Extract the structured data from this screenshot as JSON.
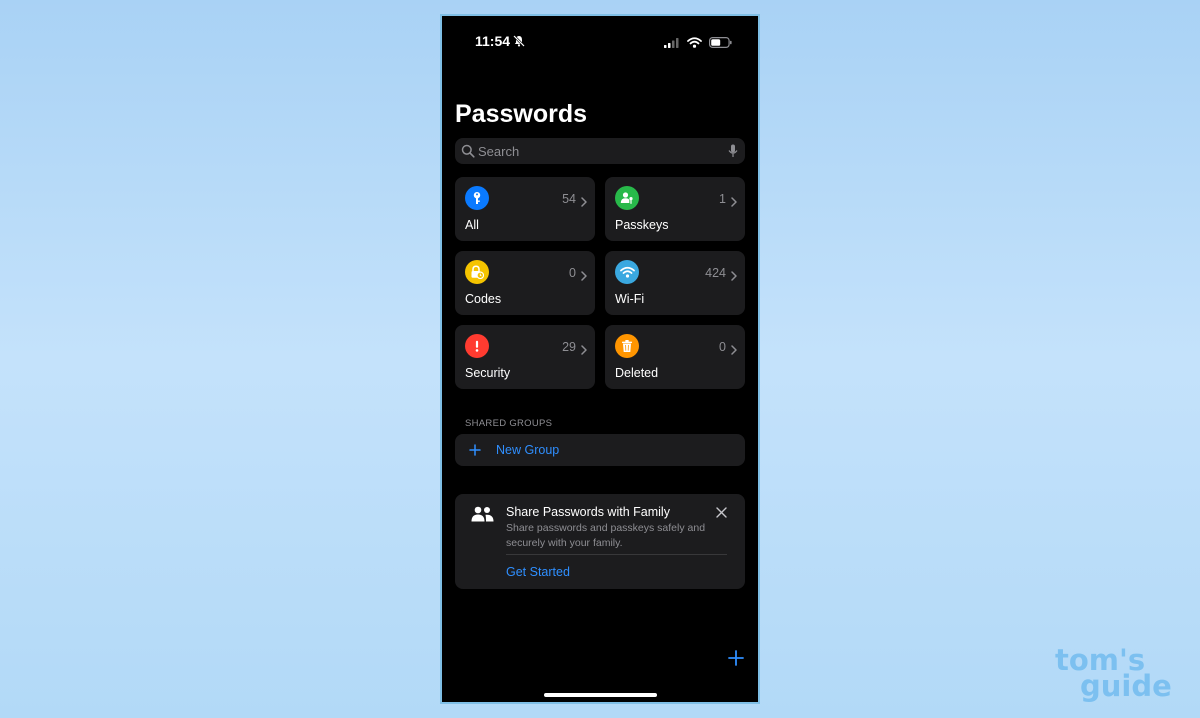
{
  "status": {
    "time": "11:54"
  },
  "title": "Passwords",
  "search": {
    "placeholder": "Search"
  },
  "tiles": [
    {
      "label": "All",
      "count": "54",
      "icon": "key-icon",
      "color": "#0a7aff"
    },
    {
      "label": "Passkeys",
      "count": "1",
      "icon": "person-key-icon",
      "color": "#28b94a"
    },
    {
      "label": "Codes",
      "count": "0",
      "icon": "lock-clock-icon",
      "color": "#f5c400"
    },
    {
      "label": "Wi-Fi",
      "count": "424",
      "icon": "wifi-icon",
      "color": "#3aa8e0"
    },
    {
      "label": "Security",
      "count": "29",
      "icon": "exclamation-icon",
      "color": "#ff3b30"
    },
    {
      "label": "Deleted",
      "count": "0",
      "icon": "trash-icon",
      "color": "#ff9500"
    }
  ],
  "shared_groups": {
    "header": "SHARED GROUPS",
    "new_group_label": "New Group"
  },
  "share_card": {
    "title": "Share Passwords with Family",
    "description": "Share passwords and passkeys safely and securely with your family.",
    "action_label": "Get Started"
  },
  "watermark": {
    "line1": "tom's",
    "line2": "guide"
  },
  "colors": {
    "accent": "#2f8fff",
    "tile_bg": "#1c1c1e",
    "background": "#000000"
  }
}
